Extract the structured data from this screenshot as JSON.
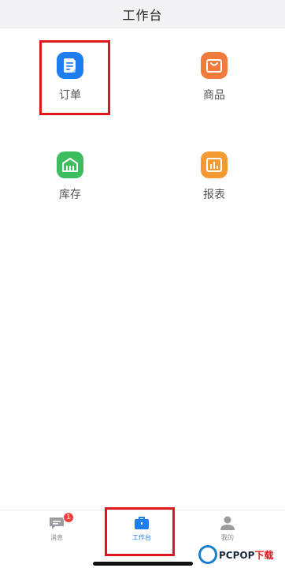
{
  "header": {
    "title": "工作台"
  },
  "grid": {
    "order": {
      "label": "订单",
      "icon": "document-icon",
      "color": "#1e7ef0"
    },
    "goods": {
      "label": "商品",
      "icon": "shopping-bag-icon",
      "color": "#f07b3c"
    },
    "stock": {
      "label": "库存",
      "icon": "warehouse-icon",
      "color": "#3dbd5f"
    },
    "report": {
      "label": "报表",
      "icon": "bar-chart-icon",
      "color": "#f49a33"
    }
  },
  "tabbar": {
    "messages": {
      "label": "消息",
      "badge": "1",
      "icon": "message-icon"
    },
    "workbench": {
      "label": "工作台",
      "icon": "briefcase-icon",
      "active": true,
      "color": "#1e7ef0"
    },
    "mine": {
      "label": "我的",
      "icon": "person-icon"
    }
  },
  "watermark": {
    "brand": "PCPOP",
    "suffix": "下载"
  }
}
